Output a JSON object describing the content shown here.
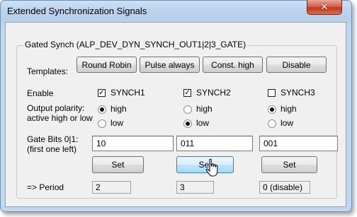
{
  "window": {
    "title": "Extended Synchronization Signals",
    "close_glyph": "✕"
  },
  "group": {
    "title": "Gated Synch (ALP_DEV_DYN_SYNCH_OUT1|2|3_GATE)"
  },
  "templates": {
    "label": "Templates:",
    "buttons": [
      "Round Robin",
      "Pulse always",
      "Const. high",
      "Disable"
    ]
  },
  "labels": {
    "enable": "Enable",
    "polarity_line1": "Output polarity:",
    "polarity_line2": "active high or low",
    "gate_line1": "Gate Bits 0|1:",
    "gate_line2": "(first one left)",
    "period": "=> Period"
  },
  "channels": [
    {
      "name": "SYNCH1",
      "enabled": true,
      "polarity": "high",
      "gate_bits": "10",
      "set_label": "Set",
      "period": "2"
    },
    {
      "name": "SYNCH2",
      "enabled": true,
      "polarity": "low",
      "gate_bits": "011",
      "set_label": "Set",
      "period": "3"
    },
    {
      "name": "SYNCH3",
      "enabled": false,
      "polarity": "high",
      "gate_bits": "001",
      "set_label": "Set",
      "period": "0 (disable)"
    }
  ],
  "polarity_options": {
    "high": "high",
    "low": "low"
  },
  "check_glyph": "✓",
  "colors": {
    "close_button": "#c2391f",
    "title_bar": "#bcd3ec",
    "dialog_bg": "#f0f0f0"
  }
}
